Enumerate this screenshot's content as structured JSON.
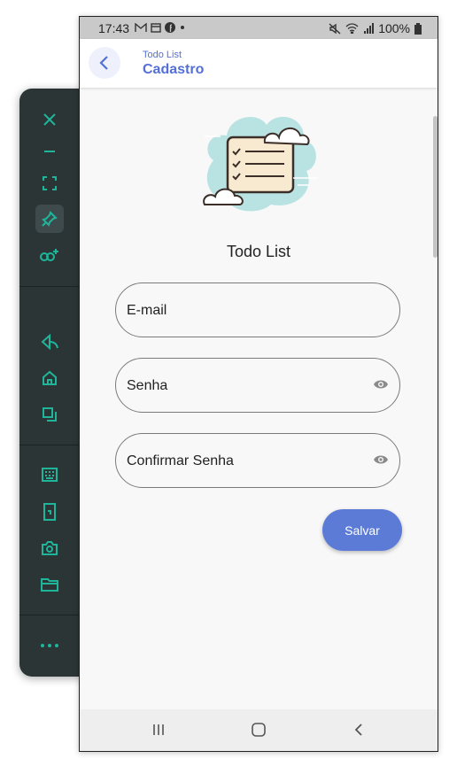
{
  "statusbar": {
    "time": "17:43",
    "battery": "100%"
  },
  "appbar": {
    "subtitle": "Todo List",
    "title": "Cadastro"
  },
  "main": {
    "heading": "Todo List",
    "fields": [
      {
        "label": "E-mail",
        "has_eye": false
      },
      {
        "label": "Senha",
        "has_eye": true
      },
      {
        "label": "Confirmar Senha",
        "has_eye": true
      }
    ],
    "save_label": "Salvar"
  },
  "toolbar_icons": [
    "close-icon",
    "minimize-icon",
    "fullscreen-icon",
    "pin-icon",
    "link-icon",
    "back-icon",
    "home-icon",
    "overview-icon",
    "keyboard-icon",
    "phone-icon",
    "camera-icon",
    "folder-icon",
    "more-icon"
  ],
  "colors": {
    "accent": "#5c7bd6",
    "toolbar_bg": "#2b3536",
    "toolbar_icon": "#1fb59b"
  }
}
